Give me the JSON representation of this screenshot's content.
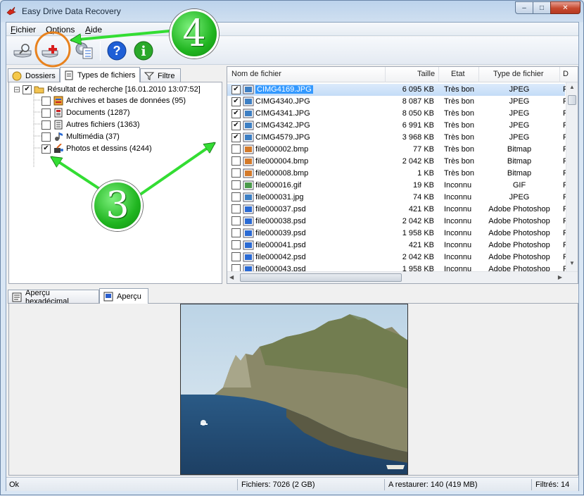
{
  "window": {
    "title": "Easy Drive Data Recovery",
    "controls": {
      "minimize": "–",
      "maximize": "□",
      "close": "✕"
    }
  },
  "menu": {
    "items": [
      "Fichier",
      "Options",
      "Aide"
    ]
  },
  "toolbar": {
    "buttons": [
      {
        "name": "scan-drive",
        "icon": "drive-search-icon"
      },
      {
        "name": "restore",
        "icon": "drive-restore-icon"
      },
      {
        "name": "settings",
        "icon": "gear-checklist-icon"
      },
      {
        "name": "help",
        "icon": "help-icon",
        "glyph": "?"
      },
      {
        "name": "info",
        "icon": "info-icon",
        "glyph": "i"
      }
    ]
  },
  "left_tabs": [
    {
      "label": "Dossiers",
      "icon": "folder-icon",
      "active": false
    },
    {
      "label": "Types de fichiers",
      "icon": "file-types-icon",
      "active": true
    },
    {
      "label": "Filtre",
      "icon": "filter-icon",
      "active": false
    }
  ],
  "tree": {
    "root": {
      "label": "Résultat de recherche [16.01.2010 13:07:52]",
      "checked": true,
      "expander": "⊟"
    },
    "children": [
      {
        "label": "Archives et bases de données (95)",
        "checked": false,
        "icon": "archive-icon"
      },
      {
        "label": "Documents (1287)",
        "checked": false,
        "icon": "document-icon"
      },
      {
        "label": "Autres fichiers (1363)",
        "checked": false,
        "icon": "other-files-icon"
      },
      {
        "label": "Multimédia (37)",
        "checked": false,
        "icon": "multimedia-icon"
      },
      {
        "label": "Photos et dessins (4244)",
        "checked": true,
        "icon": "paint-icon"
      }
    ]
  },
  "file_list": {
    "columns": [
      "Nom de fichier",
      "Taille",
      "Etat",
      "Type de fichier",
      "D"
    ],
    "rows": [
      {
        "name": "CIMG4169.JPG",
        "size": "6 095 KB",
        "state": "Très bon",
        "type": "JPEG",
        "d": "F",
        "checked": true,
        "selected": true,
        "icon": "image-icon"
      },
      {
        "name": "CIMG4340.JPG",
        "size": "8 087 KB",
        "state": "Très bon",
        "type": "JPEG",
        "d": "F",
        "checked": true,
        "icon": "image-icon"
      },
      {
        "name": "CIMG4341.JPG",
        "size": "8 050 KB",
        "state": "Très bon",
        "type": "JPEG",
        "d": "F",
        "checked": true,
        "icon": "image-icon"
      },
      {
        "name": "CIMG4342.JPG",
        "size": "6 991 KB",
        "state": "Très bon",
        "type": "JPEG",
        "d": "F",
        "checked": true,
        "icon": "image-icon"
      },
      {
        "name": "CIMG4579.JPG",
        "size": "3 968 KB",
        "state": "Très bon",
        "type": "JPEG",
        "d": "F",
        "checked": true,
        "icon": "image-icon"
      },
      {
        "name": "file000002.bmp",
        "size": "77 KB",
        "state": "Très bon",
        "type": "Bitmap",
        "d": "F",
        "checked": false,
        "icon": "bitmap-icon"
      },
      {
        "name": "file000004.bmp",
        "size": "2 042 KB",
        "state": "Très bon",
        "type": "Bitmap",
        "d": "F",
        "checked": false,
        "icon": "bitmap-icon"
      },
      {
        "name": "file000008.bmp",
        "size": "1 KB",
        "state": "Très bon",
        "type": "Bitmap",
        "d": "F",
        "checked": false,
        "icon": "bitmap-icon"
      },
      {
        "name": "file000016.gif",
        "size": "19 KB",
        "state": "Inconnu",
        "type": "GIF",
        "d": "F",
        "checked": false,
        "icon": "gif-icon"
      },
      {
        "name": "file000031.jpg",
        "size": "74 KB",
        "state": "Inconnu",
        "type": "JPEG",
        "d": "F",
        "checked": false,
        "icon": "image-icon"
      },
      {
        "name": "file000037.psd",
        "size": "421 KB",
        "state": "Inconnu",
        "type": "Adobe Photoshop",
        "d": "F",
        "checked": false,
        "icon": "psd-icon"
      },
      {
        "name": "file000038.psd",
        "size": "2 042 KB",
        "state": "Inconnu",
        "type": "Adobe Photoshop",
        "d": "F",
        "checked": false,
        "icon": "psd-icon"
      },
      {
        "name": "file000039.psd",
        "size": "1 958 KB",
        "state": "Inconnu",
        "type": "Adobe Photoshop",
        "d": "F",
        "checked": false,
        "icon": "psd-icon"
      },
      {
        "name": "file000041.psd",
        "size": "421 KB",
        "state": "Inconnu",
        "type": "Adobe Photoshop",
        "d": "F",
        "checked": false,
        "icon": "psd-icon"
      },
      {
        "name": "file000042.psd",
        "size": "2 042 KB",
        "state": "Inconnu",
        "type": "Adobe Photoshop",
        "d": "F",
        "checked": false,
        "icon": "psd-icon"
      },
      {
        "name": "file000043.psd",
        "size": "1 958 KB",
        "state": "Inconnu",
        "type": "Adobe Photoshop",
        "d": "F",
        "checked": false,
        "icon": "psd-icon"
      }
    ]
  },
  "bottom_tabs": [
    {
      "label": "Aperçu hexadécimal",
      "icon": "hex-icon",
      "active": false
    },
    {
      "label": "Aperçu",
      "icon": "preview-icon",
      "active": true
    }
  ],
  "status": {
    "left": "Ok",
    "files": "Fichiers: 7026 (2 GB)",
    "restore": "A restaurer: 140 (419 MB)",
    "filtered": "Filtrés: 14"
  },
  "annotations": {
    "step_4": "4",
    "step_3": "3",
    "arrow_color": "#33dd33",
    "highlight_color": "#e8821e"
  },
  "colors": {
    "accent": "#3399ff",
    "title_bg": "#bcd3ec"
  }
}
